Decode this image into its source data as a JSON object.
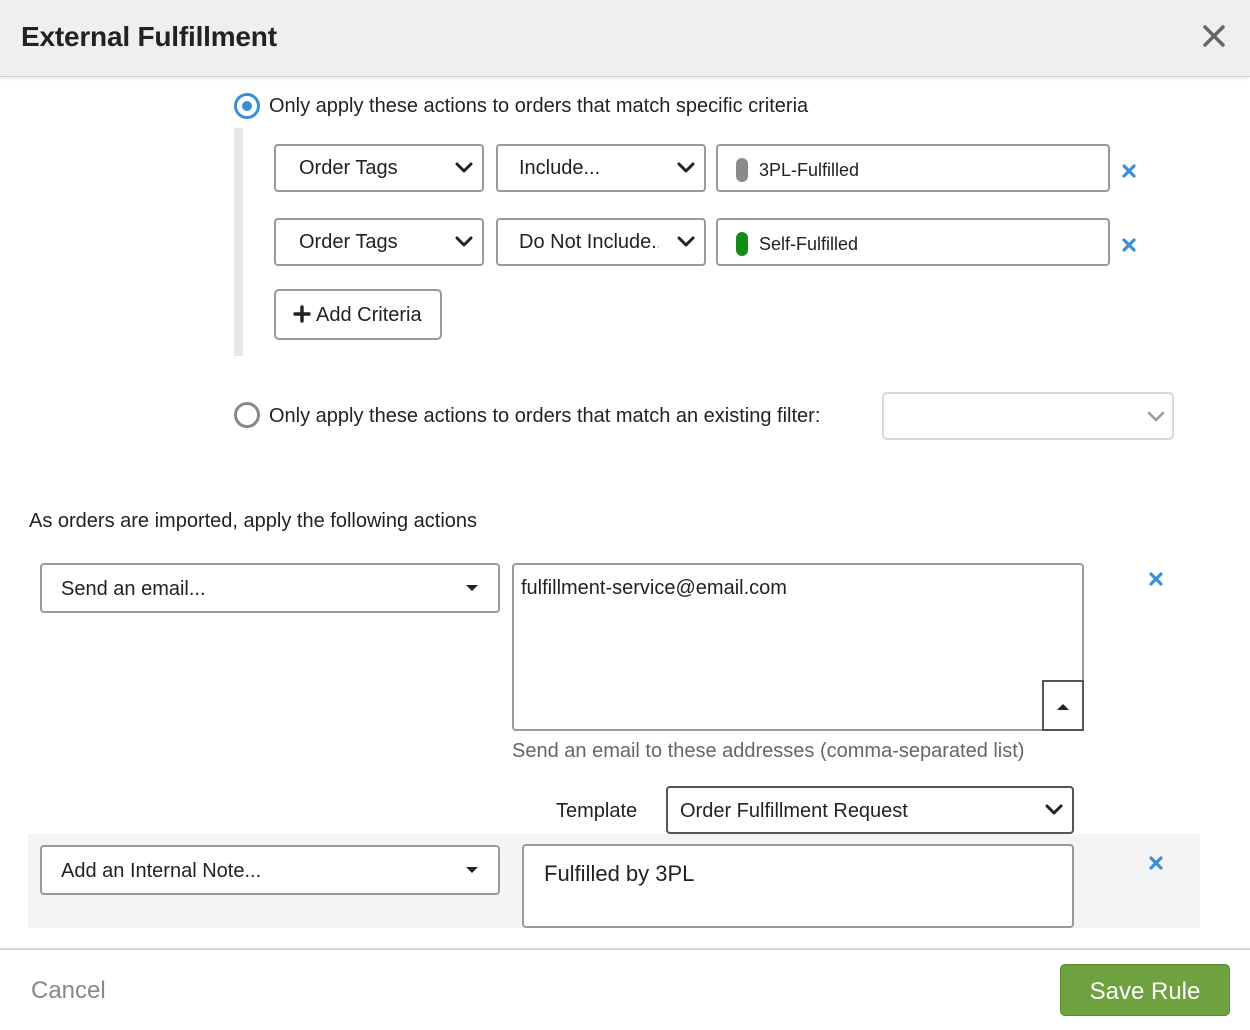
{
  "header": {
    "title": "External Fulfillment",
    "close_icon": "close-icon"
  },
  "criteria_mode": {
    "specific": {
      "label": "Only apply these actions to orders that match specific criteria",
      "selected": true
    },
    "existing_filter": {
      "label": "Only apply these actions to orders that match an existing filter:",
      "selected": false,
      "filter_value": ""
    }
  },
  "criteria": [
    {
      "field": "Order Tags",
      "operator": "Include...",
      "tag": {
        "label": "3PL-Fulfilled",
        "color": "#8a8a8a"
      }
    },
    {
      "field": "Order Tags",
      "operator": "Do Not Include...",
      "tag": {
        "label": "Self-Fulfilled",
        "color": "#168a16"
      }
    }
  ],
  "add_criteria_label": "Add Criteria",
  "actions_heading": "As orders are imported, apply the following actions",
  "actions": {
    "email": {
      "action": "Send an email...",
      "recipients": "fulfillment-service@email.com",
      "help": "Send an email to these addresses (comma-separated list)",
      "template_label": "Template",
      "template_value": "Order Fulfillment Request"
    },
    "note": {
      "action": "Add an Internal Note...",
      "text": "Fulfilled by 3PL"
    }
  },
  "footer": {
    "cancel_label": "Cancel",
    "save_label": "Save Rule",
    "save_color": "#6ea23f"
  },
  "colors": {
    "accent": "#3a8fd6",
    "remove_icon": "#3a8fd6"
  }
}
